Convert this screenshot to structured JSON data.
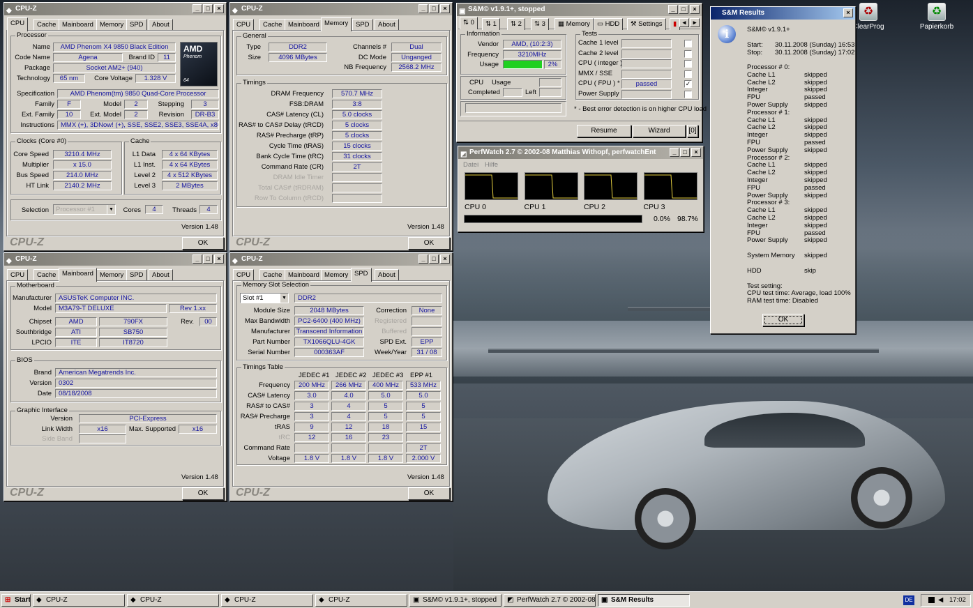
{
  "desktop": {
    "icons": [
      {
        "label": "ClearProg",
        "icon": "recycle-icon"
      },
      {
        "label": "Papierkorb",
        "icon": "recycle-bin-icon"
      }
    ]
  },
  "cpuz_title": "CPU-Z",
  "cpuz_version": "Version 1.48",
  "cpuz_ok": "OK",
  "cpuz_watermark": "CPU-Z",
  "cpuz_tabs": [
    "CPU",
    "Cache",
    "Mainboard",
    "Memory",
    "SPD",
    "About"
  ],
  "cpu": {
    "processor_group": "Processor",
    "labels": {
      "name": "Name",
      "code_name": "Code Name",
      "brand_id": "Brand ID",
      "package": "Package",
      "technology": "Technology",
      "core_voltage": "Core Voltage",
      "specification": "Specification",
      "family": "Family",
      "model": "Model",
      "stepping": "Stepping",
      "ext_family": "Ext. Family",
      "ext_model": "Ext. Model",
      "revision": "Revision",
      "instructions": "Instructions"
    },
    "name": "AMD Phenom X4 9850 Black Edition",
    "code_name": "Agena",
    "brand_id": "11",
    "package": "Socket AM2+ (940)",
    "technology": "65 nm",
    "core_voltage": "1.328 V",
    "specification": "AMD Phenom(tm) 9850 Quad-Core Processor",
    "family": "F",
    "model": "2",
    "stepping": "3",
    "ext_family": "10",
    "ext_model": "2",
    "revision": "DR-B3",
    "instructions": "MMX (+), 3DNow! (+), SSE, SSE2, SSE3, SSE4A, x86-64",
    "logo_brand": "AMD",
    "logo_line": "Phenom",
    "logo_bits": "64",
    "clocks_group": "Clocks (Core #0)",
    "cache_group": "Cache",
    "clock_labels": [
      "Core Speed",
      "Multiplier",
      "Bus Speed",
      "HT Link"
    ],
    "clock_values": [
      "3210.4 MHz",
      "x 15.0",
      "214.0 MHz",
      "2140.2 MHz"
    ],
    "cache_labels": [
      "L1 Data",
      "L1 Inst.",
      "Level 2",
      "Level 3"
    ],
    "cache_values": [
      "4 x 64 KBytes",
      "4 x 64 KBytes",
      "4 x 512 KBytes",
      "2 MBytes"
    ],
    "selection_label": "Selection",
    "selection_value": "Processor #1",
    "cores_label": "Cores",
    "cores": "4",
    "threads_label": "Threads",
    "threads": "4"
  },
  "memory": {
    "general_group": "General",
    "timings_group": "Timings",
    "type_label": "Type",
    "type": "DDR2",
    "size_label": "Size",
    "size": "4096 MBytes",
    "channels_label": "Channels #",
    "channels": "Dual",
    "dc_label": "DC Mode",
    "dc_mode": "Unganged",
    "nb_label": "NB Frequency",
    "nb_freq": "2568.2 MHz",
    "timing_labels": [
      "DRAM Frequency",
      "FSB:DRAM",
      "CAS# Latency (CL)",
      "RAS# to CAS# Delay (tRCD)",
      "RAS# Precharge (tRP)",
      "Cycle Time (tRAS)",
      "Bank Cycle Time (tRC)",
      "Command Rate (CR)",
      "DRAM Idle Timer",
      "Total CAS# (tRDRAM)",
      "Row To Column (tRCD)"
    ],
    "timing_values": [
      "570.7 MHz",
      "3:8",
      "5.0 clocks",
      "5 clocks",
      "5 clocks",
      "15 clocks",
      "31 clocks",
      "2T",
      "",
      "",
      ""
    ]
  },
  "mainboard": {
    "mb_group": "Motherboard",
    "bios_group": "BIOS",
    "gfx_group": "Graphic Interface",
    "manufacturer_label": "Manufacturer",
    "manufacturer": "ASUSTeK Computer INC.",
    "model_label": "Model",
    "model": "M3A79-T DELUXE",
    "model_rev": "Rev 1.xx",
    "chipset_label": "Chipset",
    "chipset_vendor": "AMD",
    "chipset": "790FX",
    "rev_label": "Rev.",
    "chipset_rev": "00",
    "sb_label": "Southbridge",
    "sb_vendor": "ATI",
    "sb": "SB750",
    "lpcio_label": "LPCIO",
    "lpcio_vendor": "ITE",
    "lpcio": "IT8720",
    "bios_brand_label": "Brand",
    "bios_brand": "American Megatrends Inc.",
    "bios_version_label": "Version",
    "bios_version": "0302",
    "bios_date_label": "Date",
    "bios_date": "08/18/2008",
    "gfx_version_label": "Version",
    "gfx_version": "PCI-Express",
    "link_width_label": "Link Width",
    "link_width": "x16",
    "max_supported_label": "Max. Supported",
    "max_supported": "x16",
    "side_band_label": "Side Band"
  },
  "spd": {
    "slot_group": "Memory Slot Selection",
    "slot": "Slot #1",
    "slot_type": "DDR2",
    "labels": [
      "Module Size",
      "Max Bandwidth",
      "Manufacturer",
      "Part Number",
      "Serial Number"
    ],
    "values": [
      "2048 MBytes",
      "PC2-6400 (400 MHz)",
      "Transcend Information",
      "TX1066QLU-4GK",
      "000363AF"
    ],
    "right_labels": [
      "Correction",
      "Registered",
      "Buffered",
      "SPD Ext.",
      "Week/Year"
    ],
    "right_values": [
      "None",
      "",
      "",
      "EPP",
      "31 / 08"
    ],
    "table_group": "Timings Table",
    "cols": [
      "JEDEC #1",
      "JEDEC #2",
      "JEDEC #3",
      "EPP #1"
    ],
    "rows": [
      {
        "label": "Frequency",
        "v": [
          "200 MHz",
          "266 MHz",
          "400 MHz",
          "533 MHz"
        ]
      },
      {
        "label": "CAS# Latency",
        "v": [
          "3.0",
          "4.0",
          "5.0",
          "5.0"
        ]
      },
      {
        "label": "RAS# to CAS#",
        "v": [
          "3",
          "4",
          "5",
          "5"
        ]
      },
      {
        "label": "RAS# Precharge",
        "v": [
          "3",
          "4",
          "5",
          "5"
        ]
      },
      {
        "label": "tRAS",
        "v": [
          "9",
          "12",
          "18",
          "15"
        ]
      },
      {
        "label": "tRC",
        "v": [
          "12",
          "16",
          "23",
          ""
        ]
      },
      {
        "label": "Command Rate",
        "v": [
          "",
          "",
          "",
          "2T"
        ]
      },
      {
        "label": "Voltage",
        "v": [
          "1.8 V",
          "1.8 V",
          "1.8 V",
          "2.000 V"
        ]
      }
    ]
  },
  "sm": {
    "title": "S&M© v1.9.1+, stopped",
    "tabs": [
      "0",
      "1",
      "2",
      "3",
      "Memory",
      "HDD",
      "Settings"
    ],
    "info_group": "Information",
    "tests_group": "Tests",
    "vendor_label": "Vendor",
    "vendor": "AMD, (10:2:3)",
    "freq_label": "Frequency",
    "freq": "3210MHz",
    "usage_label": "Usage",
    "usage": "2%",
    "usage_fill": 1.0,
    "cpu_label": "CPU",
    "cpu_usage_label": "Usage",
    "completed_label": "Completed",
    "left_label": "Left",
    "tests": [
      {
        "label": "Cache 1 level",
        "result": "",
        "checked": false
      },
      {
        "label": "Cache 2 level",
        "result": "",
        "checked": false
      },
      {
        "label": "CPU ( integer )",
        "result": "",
        "checked": false
      },
      {
        "label": "MMX  /  SSE",
        "result": "",
        "checked": false
      },
      {
        "label": "CPU ( FPU ) *",
        "result": "passed",
        "checked": true
      },
      {
        "label": "Power Supply",
        "result": "",
        "checked": false
      }
    ],
    "note": "* - Best error detection is on higher CPU load",
    "resume": "Resume",
    "wizard": "Wizard",
    "count": "[0]"
  },
  "perfwatch": {
    "title": "PerfWatch 2.7 © 2002-08 Matthias Withopf, perfwatchEnt",
    "menu": [
      "Datei",
      "Hilfe"
    ],
    "cpus": [
      "CPU 0",
      "CPU 1",
      "CPU 2",
      "CPU 3"
    ],
    "low": "0.0%",
    "high": "98.7%"
  },
  "results": {
    "title": "S&M Results",
    "app": "S&M© v1.9.1+",
    "start_label": "Start:",
    "start": "30.11.2008 (Sunday) 16:53",
    "stop_label": "Stop:",
    "stop": "30.11.2008 (Sunday) 17:02",
    "processors": [
      {
        "header": "Processor #  0:",
        "items": [
          [
            "Cache L1",
            "skipped"
          ],
          [
            "Cache L2",
            "skipped"
          ],
          [
            "Integer",
            "skipped"
          ],
          [
            "FPU",
            "passed"
          ],
          [
            "Power Supply",
            "skipped"
          ]
        ]
      },
      {
        "header": "Processor #  1:",
        "items": [
          [
            "Cache L1",
            "skipped"
          ],
          [
            "Cache L2",
            "skipped"
          ],
          [
            "Integer",
            "skipped"
          ],
          [
            "FPU",
            "passed"
          ],
          [
            "Power Supply",
            "skipped"
          ]
        ]
      },
      {
        "header": "Processor #  2:",
        "items": [
          [
            "Cache L1",
            "skipped"
          ],
          [
            "Cache L2",
            "skipped"
          ],
          [
            "Integer",
            "skipped"
          ],
          [
            "FPU",
            "passed"
          ],
          [
            "Power Supply",
            "skipped"
          ]
        ]
      },
      {
        "header": "Processor #  3:",
        "items": [
          [
            "Cache L1",
            "skipped"
          ],
          [
            "Cache L2",
            "skipped"
          ],
          [
            "Integer",
            "skipped"
          ],
          [
            "FPU",
            "passed"
          ],
          [
            "Power Supply",
            "skipped"
          ]
        ]
      }
    ],
    "sysmem_label": "System Memory",
    "sysmem": "skipped",
    "hdd_label": "HDD",
    "hdd": "skip",
    "settings_title": "Test setting:",
    "settings_cpu": "CPU test time: Average, load 100%",
    "settings_ram": "RAM test time: Disabled",
    "ok": "OK"
  },
  "taskbar": {
    "start": "Start",
    "items": [
      "CPU-Z",
      "CPU-Z",
      "CPU-Z",
      "CPU-Z",
      "S&M© v1.9.1+, stopped",
      "PerfWatch 2.7 © 2002-08...",
      "S&M Results"
    ],
    "lang": "DE",
    "clock": "17:02"
  }
}
